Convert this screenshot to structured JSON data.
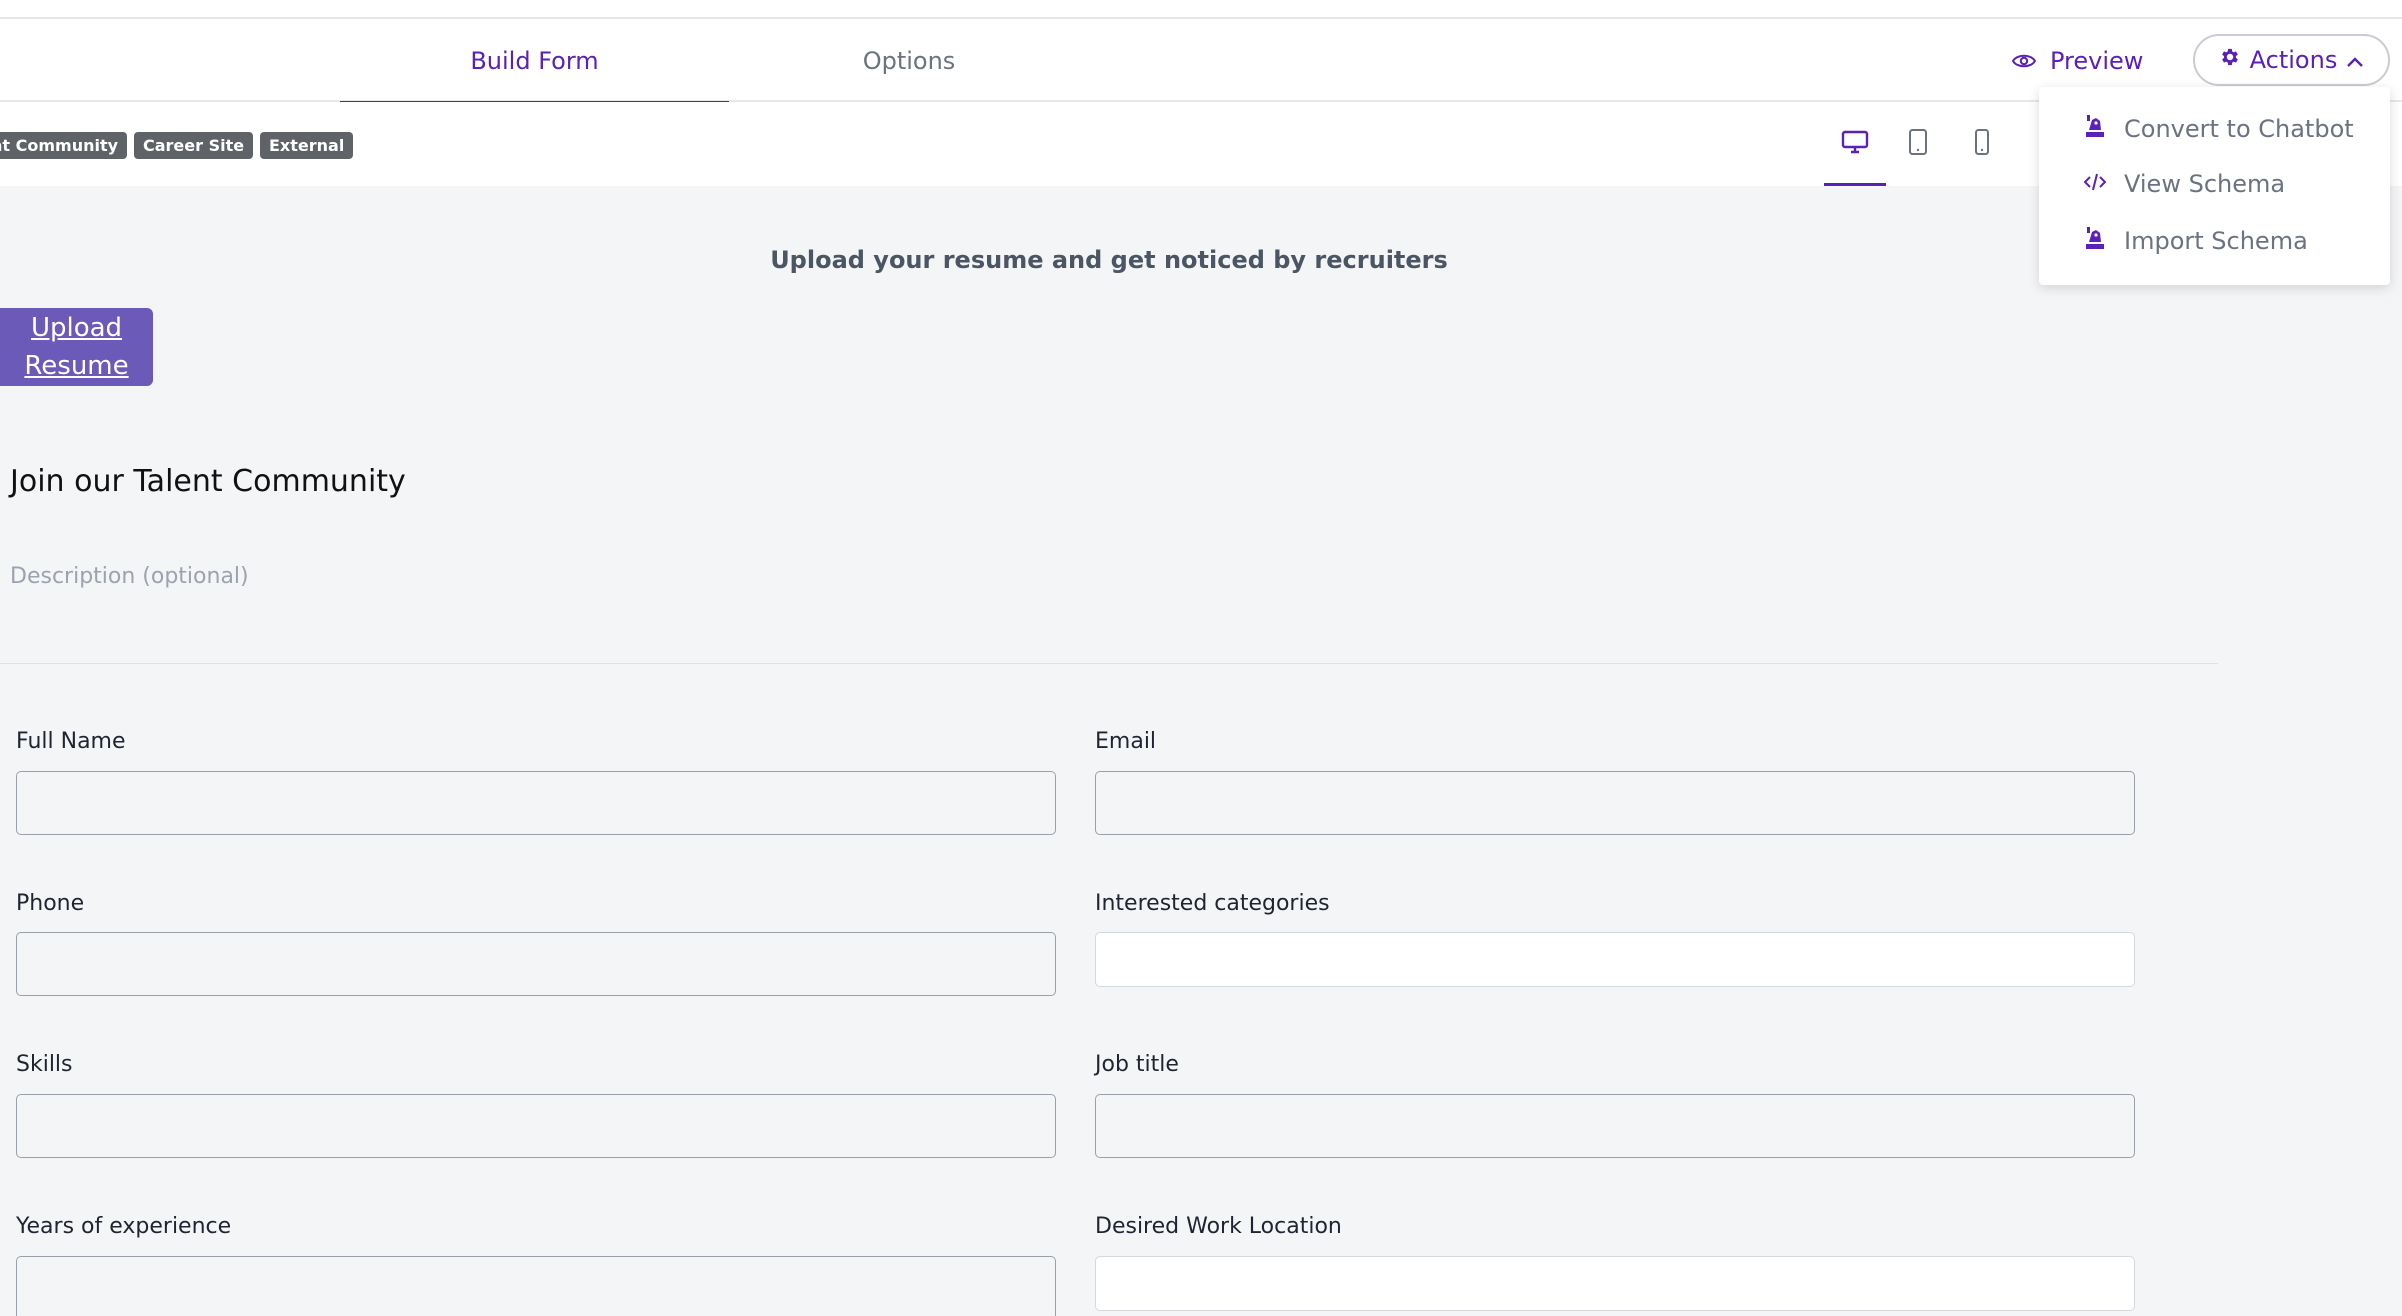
{
  "tabs": [
    {
      "label": "Build Form",
      "active": true
    },
    {
      "label": "Options",
      "active": false
    }
  ],
  "header": {
    "preview_label": "Preview",
    "actions_label": "Actions"
  },
  "actions_menu": {
    "items": [
      {
        "label": "Convert to Chatbot",
        "icon": "robot-icon"
      },
      {
        "label": "View Schema",
        "icon": "code-icon"
      },
      {
        "label": "Import Schema",
        "icon": "robot-icon"
      }
    ]
  },
  "badges": [
    "nt Community",
    "Career Site",
    "External"
  ],
  "devices": [
    {
      "name": "desktop",
      "active": true
    },
    {
      "name": "tablet",
      "active": false
    },
    {
      "name": "mobile",
      "active": false
    }
  ],
  "form": {
    "upload_tagline": "Upload your resume and get noticed by recruiters",
    "upload_button_line1": "Upload",
    "upload_button_line2": "Resume",
    "title": "Join our Talent Community",
    "description_placeholder": "Description (optional)",
    "fields": [
      {
        "label": "Full Name",
        "value": ""
      },
      {
        "label": "Email",
        "value": ""
      },
      {
        "label": "Phone",
        "value": ""
      },
      {
        "label": "Interested categories",
        "value": ""
      },
      {
        "label": "Skills",
        "value": ""
      },
      {
        "label": "Job title",
        "value": ""
      },
      {
        "label": "Years of experience",
        "value": ""
      },
      {
        "label": "Desired Work Location",
        "value": ""
      }
    ]
  },
  "colors": {
    "accent": "#5b21b6",
    "upload_button": "#6b5ab8",
    "badge": "#5f6368",
    "canvas_bg": "#f4f5f7"
  }
}
